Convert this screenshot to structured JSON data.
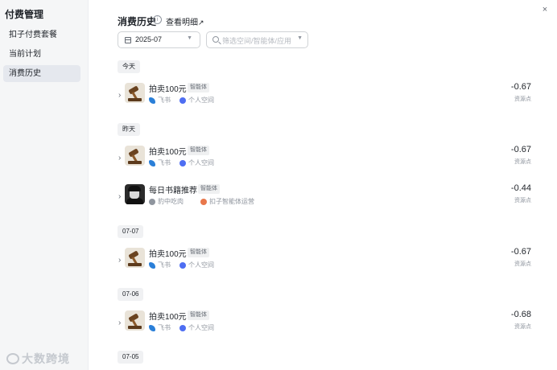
{
  "sidebar": {
    "title": "付费管理",
    "items": [
      {
        "label": "扣子付费套餐"
      },
      {
        "label": "当前计划"
      },
      {
        "label": "消费历史"
      }
    ]
  },
  "header": {
    "title": "消费历史",
    "info_icon": "info-icon",
    "detail_link": "查看明细",
    "detail_arrow": "↗",
    "close_icon": "×"
  },
  "filters": {
    "month": "2025-07",
    "search_placeholder": "筛选空间/智能体/应用"
  },
  "groups": [
    {
      "date": "今天",
      "records": [
        {
          "name": "拍卖100元",
          "tag": "智能体",
          "channel": "飞书",
          "space": "个人空间",
          "amount": "-0.67",
          "unit": "资源点"
        }
      ]
    },
    {
      "date": "昨天",
      "records": [
        {
          "name": "拍卖100元",
          "tag": "智能体",
          "channel": "飞书",
          "space": "个人空间",
          "amount": "-0.67",
          "unit": "资源点"
        },
        {
          "name": "每日书籍推荐",
          "tag": "智能体",
          "channel": "豹中吃肉",
          "space": "扣子智能体运营",
          "amount": "-0.44",
          "unit": "资源点"
        }
      ]
    },
    {
      "date": "07-07",
      "records": [
        {
          "name": "拍卖100元",
          "tag": "智能体",
          "channel": "飞书",
          "space": "个人空间",
          "amount": "-0.67",
          "unit": "资源点"
        }
      ]
    },
    {
      "date": "07-06",
      "records": [
        {
          "name": "拍卖100元",
          "tag": "智能体",
          "channel": "飞书",
          "space": "个人空间",
          "amount": "-0.68",
          "unit": "资源点"
        }
      ]
    },
    {
      "date": "07-05",
      "records": []
    }
  ],
  "watermark": "大数跨境"
}
